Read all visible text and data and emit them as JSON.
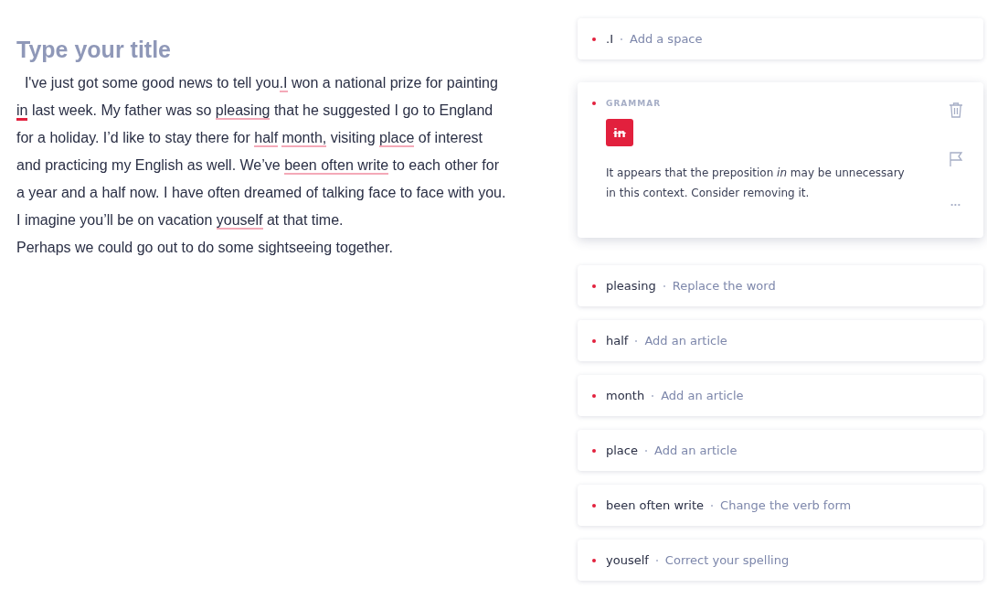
{
  "title_placeholder": "Type your title",
  "body_lines": [
    [
      {
        "text": "  I've just got some good news to tell you"
      },
      {
        "text": ".I",
        "flagged": true,
        "active": false
      },
      {
        "text": " won a national prize for painting"
      }
    ],
    [
      {
        "text": "in",
        "flagged": true,
        "active": true
      },
      {
        "text": " last week. My father was so "
      },
      {
        "text": "pleasing",
        "flagged": true,
        "active": false
      },
      {
        "text": " that he suggested I go to England"
      }
    ],
    [
      {
        "text": "for a holiday. I’d like to stay there for "
      },
      {
        "text": "half",
        "flagged": true,
        "active": false
      },
      {
        "text": "month,",
        "flagged": true,
        "active": false,
        "space_before": true
      },
      {
        "text": " visiting "
      },
      {
        "text": "place",
        "flagged": true,
        "active": false
      },
      {
        "text": " of interest"
      }
    ],
    [
      {
        "text": "and practicing my English as well. We’ve "
      },
      {
        "text": "been often write",
        "flagged": true,
        "active": false
      },
      {
        "text": " to each other for"
      }
    ],
    [
      {
        "text": "a year and a half now. I have often dreamed of talking face to face with you."
      }
    ],
    [
      {
        "text": "I imagine you’ll be on vacation "
      },
      {
        "text": "youself",
        "flagged": true,
        "active": false
      },
      {
        "text": " at that time."
      }
    ],
    [
      {
        "text": "Perhaps we could go out to do some sightseeing together."
      }
    ]
  ],
  "suggestions": [
    {
      "kind": "collapsed",
      "word": ".I",
      "action": "Add a space"
    },
    {
      "kind": "expanded",
      "category": "GRAMMAR",
      "badge": "in",
      "description": "It appears that the preposition *in* may be unnecessary in this context. Consider removing it.",
      "more": "•••"
    },
    {
      "kind": "collapsed",
      "word": "pleasing",
      "action": "Replace the word"
    },
    {
      "kind": "collapsed",
      "word": "half",
      "action": "Add an article"
    },
    {
      "kind": "collapsed",
      "word": "month",
      "action": "Add an article"
    },
    {
      "kind": "collapsed",
      "word": "place",
      "action": "Add an article"
    },
    {
      "kind": "collapsed",
      "word": "been often write",
      "action": "Change the verb form"
    },
    {
      "kind": "collapsed",
      "word": "youself",
      "action": "Correct your spelling"
    }
  ]
}
